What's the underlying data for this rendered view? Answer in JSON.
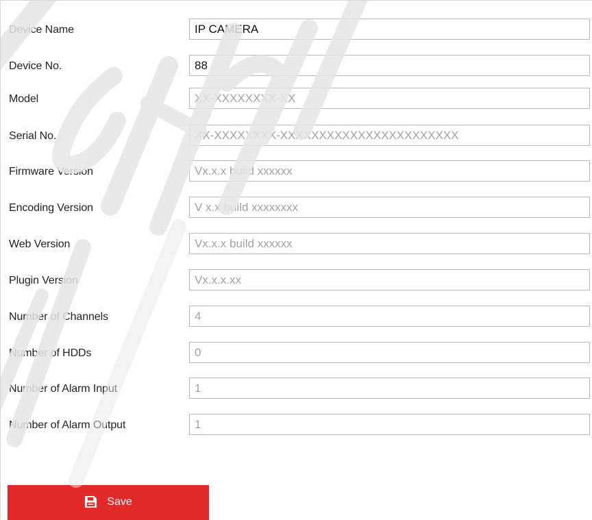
{
  "form": {
    "fields": [
      {
        "label": "Device Name",
        "value": "IP CAMERA",
        "editable": true
      },
      {
        "label": "Device No.",
        "value": "88",
        "editable": true
      },
      {
        "label": "Model",
        "value": "XX-XXXXXXXX-XX",
        "editable": false
      },
      {
        "label": "Serial No.",
        "value": "XX-XXXXXXXX-XXXXXXXXXXXXXXXXXXXXXXX",
        "editable": false
      },
      {
        "label": "Firmware Version",
        "value": "Vx.x.x build xxxxxx",
        "editable": false
      },
      {
        "label": "Encoding Version",
        "value": "V x.x build xxxxxxxx",
        "editable": false
      },
      {
        "label": "Web Version",
        "value": "Vx.x.x build xxxxxx",
        "editable": false
      },
      {
        "label": "Plugin Version",
        "value": "Vx.x.x.xx",
        "editable": false
      },
      {
        "label": "Number of Channels",
        "value": "4",
        "editable": false
      },
      {
        "label": "Number of HDDs",
        "value": "0",
        "editable": false
      },
      {
        "label": "Number of Alarm Input",
        "value": "1",
        "editable": false
      },
      {
        "label": "Number of Alarm Output",
        "value": "1",
        "editable": false
      }
    ]
  },
  "actions": {
    "save_label": "Save",
    "save_icon": "floppy-disk-icon"
  },
  "colors": {
    "accent": "#e32a2a",
    "input_border": "#b9b9b9",
    "readonly_text": "#a3a3a3",
    "watermark": "#e6e6e6"
  }
}
